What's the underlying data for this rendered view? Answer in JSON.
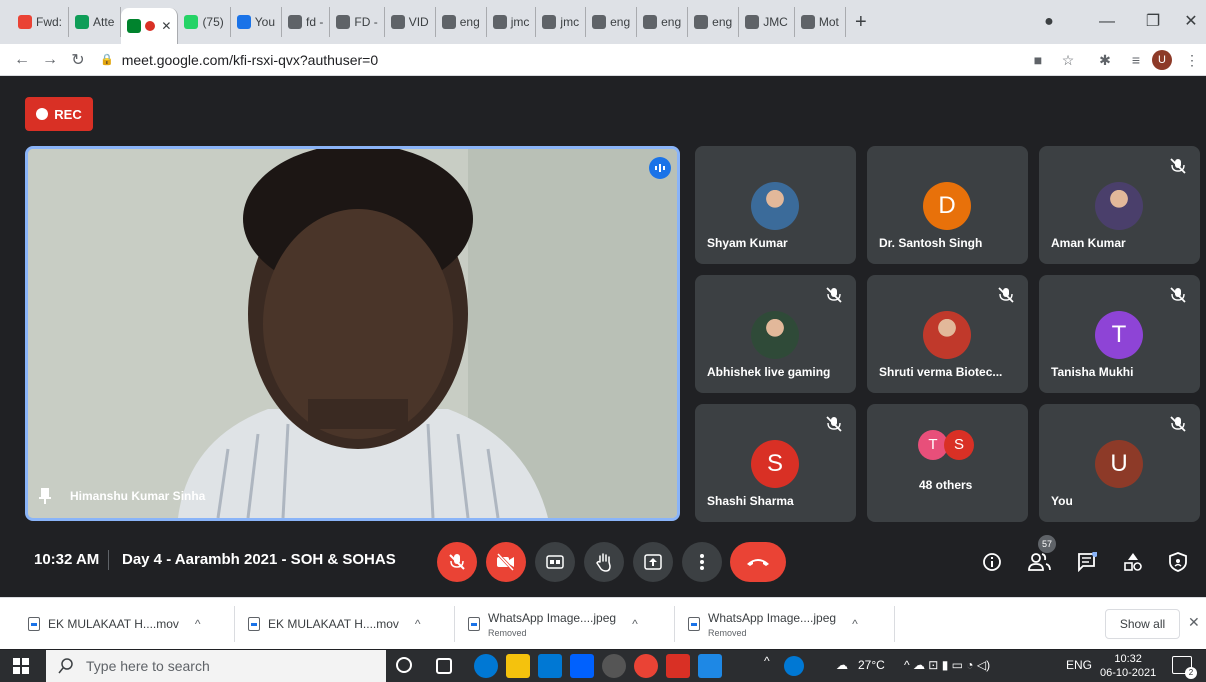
{
  "browser": {
    "tabs": [
      {
        "label": "Fwd:",
        "icon": "gmail-icon",
        "color": "#ea4335"
      },
      {
        "label": "Atte",
        "icon": "sheets-icon",
        "color": "#0f9d58"
      },
      {
        "label": "",
        "icon": "meet-icon",
        "color": "#00832d",
        "active": true
      },
      {
        "label": "(75)",
        "icon": "whatsapp-icon",
        "color": "#25d366"
      },
      {
        "label": "You",
        "icon": "s-icon",
        "color": "#1a73e8"
      },
      {
        "label": "fd -",
        "icon": "globe-icon",
        "color": "#5f6368"
      },
      {
        "label": "FD -",
        "icon": "globe-icon",
        "color": "#5f6368"
      },
      {
        "label": "VID",
        "icon": "globe-icon",
        "color": "#5f6368"
      },
      {
        "label": "eng",
        "icon": "globe-icon",
        "color": "#5f6368"
      },
      {
        "label": "jmc",
        "icon": "globe-icon",
        "color": "#5f6368"
      },
      {
        "label": "jmc",
        "icon": "globe-icon",
        "color": "#5f6368"
      },
      {
        "label": "eng",
        "icon": "globe-icon",
        "color": "#5f6368"
      },
      {
        "label": "eng",
        "icon": "globe-icon",
        "color": "#5f6368"
      },
      {
        "label": "eng",
        "icon": "globe-icon",
        "color": "#5f6368"
      },
      {
        "label": "JMC",
        "icon": "globe-icon",
        "color": "#5f6368"
      },
      {
        "label": "Mot",
        "icon": "globe-icon",
        "color": "#5f6368"
      }
    ],
    "new_tab": "+",
    "url": "meet.google.com/kfi-rsxi-qvx?authuser=0",
    "profile_initial": "U"
  },
  "meet": {
    "rec_label": "REC",
    "presenter_name": "Himanshu Kumar Sinha",
    "participants": [
      {
        "name": "Shyam Kumar",
        "avatar_type": "photo",
        "muted": false
      },
      {
        "name": "Dr. Santosh Singh",
        "avatar_type": "letter",
        "initial": "D",
        "color": "#e8710a",
        "muted": false
      },
      {
        "name": "Aman Kumar",
        "avatar_type": "photo",
        "muted": true
      },
      {
        "name": "Abhishek live gaming",
        "avatar_type": "photo",
        "muted": true
      },
      {
        "name": "Shruti verma Biotec...",
        "avatar_type": "photo",
        "muted": true
      },
      {
        "name": "Tanisha Mukhi",
        "avatar_type": "letter",
        "initial": "T",
        "color": "#8e44d6",
        "muted": true
      },
      {
        "name": "Shashi Sharma",
        "avatar_type": "letter",
        "initial": "S",
        "color": "#d93025",
        "muted": true
      },
      {
        "name": "48 others",
        "avatar_type": "group",
        "initials": [
          "T",
          "S"
        ],
        "muted": false
      },
      {
        "name": "You",
        "avatar_type": "letter",
        "initial": "U",
        "color": "#8d3a28",
        "muted": true
      }
    ],
    "time": "10:32 AM",
    "meeting_name": "Day 4 - Aarambh 2021 - SOH & SOHAS",
    "people_count": "57"
  },
  "downloads": {
    "items": [
      {
        "name": "EK MULAKAAT H....mov",
        "status": ""
      },
      {
        "name": "EK MULAKAAT H....mov",
        "status": ""
      },
      {
        "name": "WhatsApp Image....jpeg",
        "status": "Removed"
      },
      {
        "name": "WhatsApp Image....jpeg",
        "status": "Removed"
      }
    ],
    "show_all": "Show all"
  },
  "taskbar": {
    "search_placeholder": "Type here to search",
    "weather": "27°C",
    "lang": "ENG",
    "time": "10:32",
    "date": "06-10-2021",
    "notif_count": "2"
  },
  "colors": {
    "meet_bg": "#202124",
    "tile_bg": "#3c4043",
    "red": "#ea4335",
    "active_border": "#8ab4f8"
  }
}
